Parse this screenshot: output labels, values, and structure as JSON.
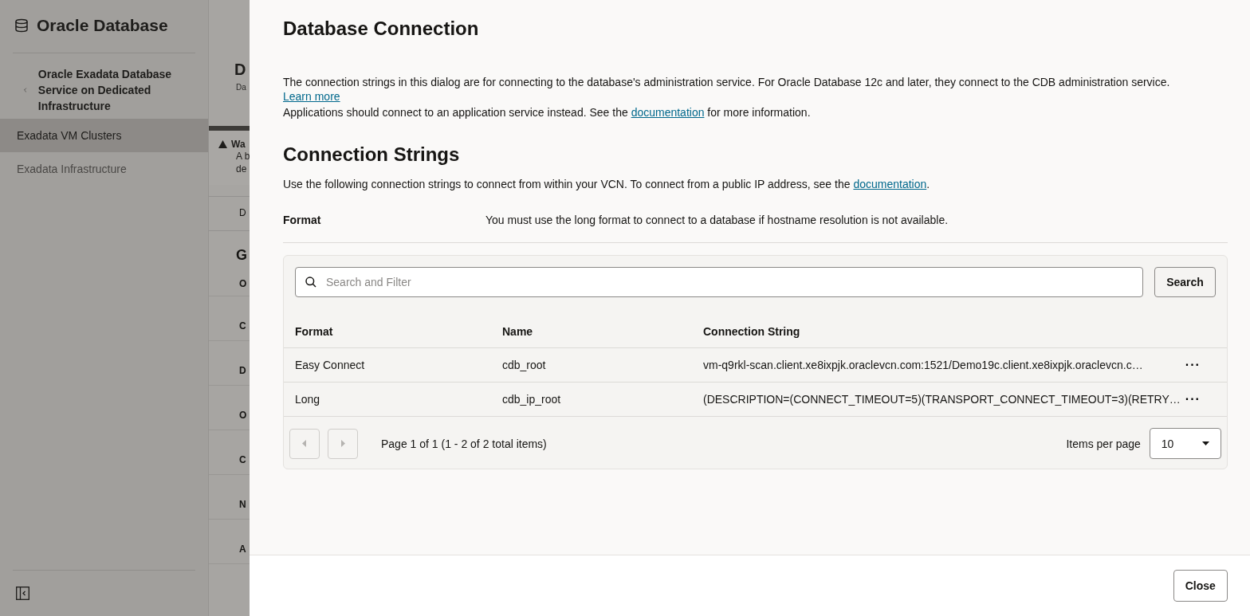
{
  "sidebar": {
    "title": "Oracle Database",
    "back_link": "Oracle Exadata Database Service on Dedicated Infrastructure",
    "items": [
      {
        "label": "Exadata VM Clusters",
        "selected": true
      },
      {
        "label": "Exadata Infrastructure",
        "selected": false
      }
    ]
  },
  "background_page": {
    "title": "D",
    "subtitle": "Da",
    "warning": {
      "title": "Wa",
      "lines": [
        "A b",
        "de"
      ]
    },
    "tab": "D",
    "heading": "G",
    "labels": [
      "O",
      "C",
      "D",
      "O",
      "C",
      "N",
      "A"
    ]
  },
  "dialog": {
    "title": "Database Connection",
    "intro": {
      "text": "The connection strings in this dialog are for connecting to the database's administration service. For Oracle Database 12c and later, they connect to the CDB administration service.",
      "link": "Learn more"
    },
    "note": {
      "before": "Applications should connect to an application service instead. See the",
      "link": "documentation",
      "after": "for more information."
    },
    "section_title": "Connection Strings",
    "section_text": {
      "before": "Use the following connection strings to connect from within your VCN. To connect from a public IP address, see the",
      "link": "documentation",
      "after": "."
    },
    "format": {
      "label": "Format",
      "value": "You must use the long format to connect to a database if hostname resolution is not available."
    },
    "table": {
      "search": {
        "placeholder": "Search and Filter"
      },
      "search_button": "Search",
      "columns": [
        "Format",
        "Name",
        "Connection String"
      ],
      "rows": [
        {
          "format": "Easy Connect",
          "name": "cdb_root",
          "connection_string": "vm-q9rkl-scan.client.xe8ixpjk.oraclevcn.com:1521/Demo19c.client.xe8ixpjk.oraclevcn.c…",
          "actions": "···"
        },
        {
          "format": "Long",
          "name": "cdb_ip_root",
          "connection_string": "(DESCRIPTION=(CONNECT_TIMEOUT=5)(TRANSPORT_CONNECT_TIMEOUT=3)(RETRY…",
          "actions": "···"
        }
      ],
      "pagination": {
        "prev_disabled": true,
        "next_disabled": true,
        "summary": "Page 1 of 1 (1 - 2 of 2 total items)",
        "per_page_label": "Items per page",
        "per_page": "10"
      }
    },
    "close_button": "Close"
  }
}
